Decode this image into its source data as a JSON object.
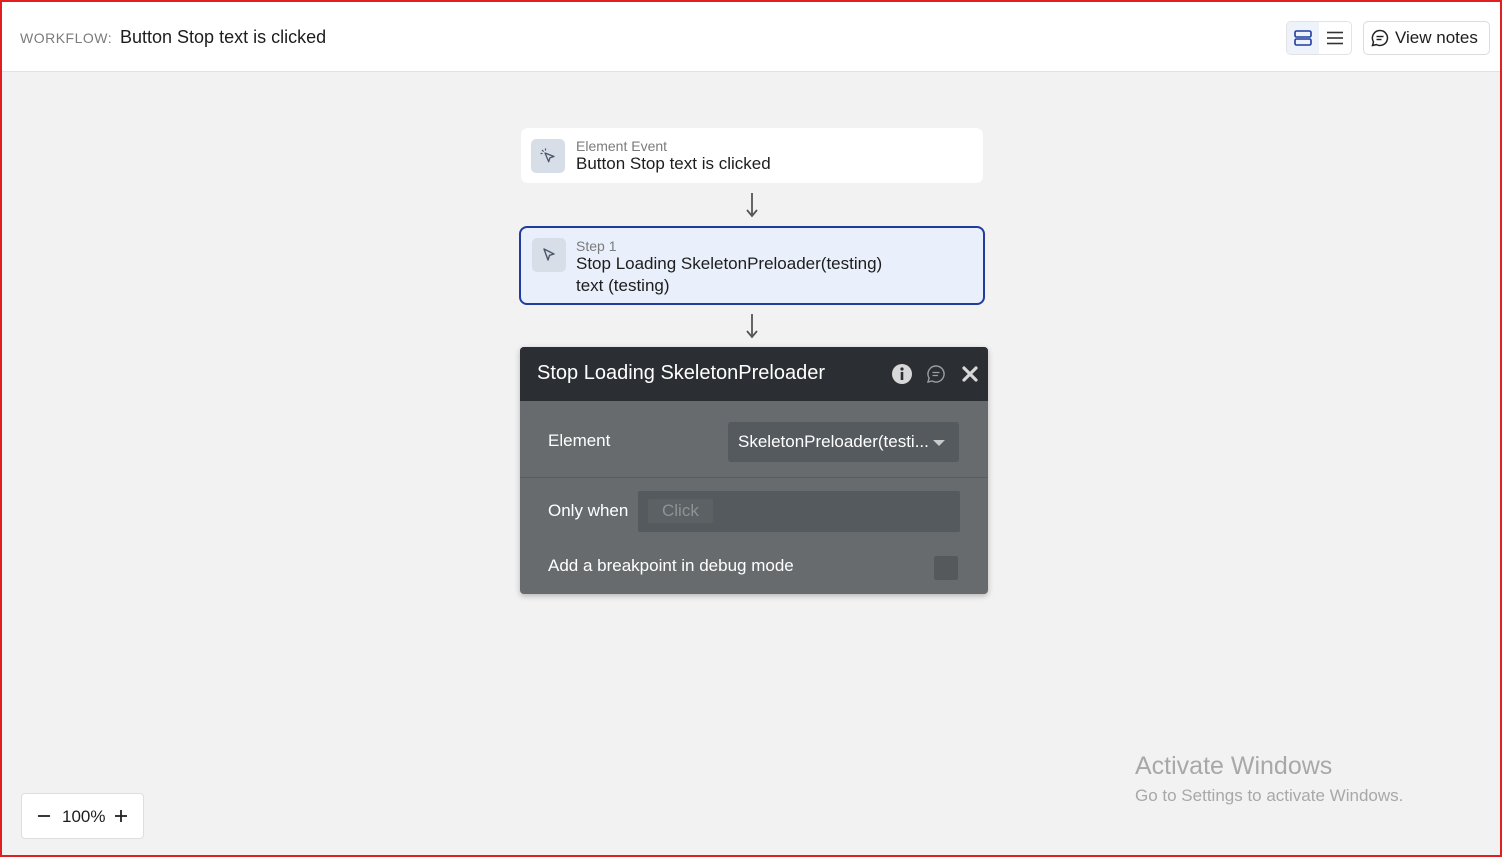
{
  "header": {
    "workflow_label": "WORKFLOW:",
    "workflow_title": "Button Stop text is clicked",
    "view_notes_label": "View notes"
  },
  "event_card": {
    "subtitle": "Element Event",
    "title": "Button Stop text is clicked",
    "icon": "pointer-click-icon"
  },
  "step_card": {
    "subtitle": "Step 1",
    "title_line1": "Stop Loading SkeletonPreloader(testing)",
    "title_line2": "text (testing)",
    "icon": "cursor-icon"
  },
  "action_panel": {
    "title": "Stop Loading SkeletonPreloader",
    "element_label": "Element",
    "element_value": "SkeletonPreloader(testi...",
    "only_when_label": "Only when",
    "only_when_placeholder": "Click",
    "breakpoint_label": "Add a breakpoint in debug mode",
    "breakpoint_checked": false
  },
  "zoom": {
    "value": "100%"
  },
  "watermark": {
    "title": "Activate Windows",
    "subtitle": "Go to Settings to activate Windows."
  },
  "colors": {
    "accent": "#1f3c9e",
    "panel_header": "#2b2f33",
    "panel_body": "#676b6e",
    "canvas": "#f2f2f2"
  }
}
